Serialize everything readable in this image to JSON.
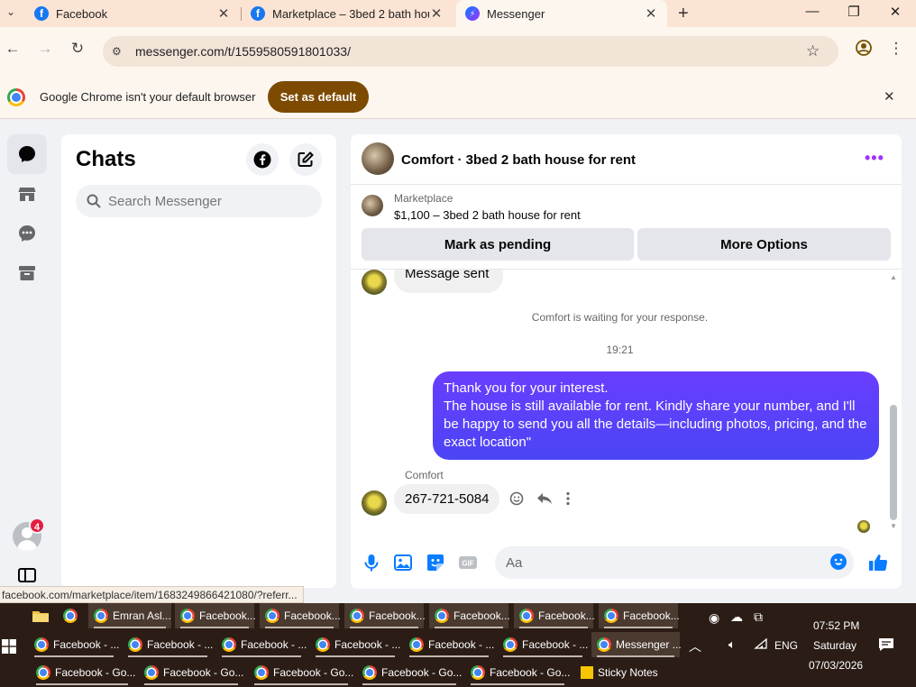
{
  "browser": {
    "tabs": [
      {
        "title": "Facebook",
        "icon": "facebook-icon"
      },
      {
        "title": "Marketplace – 3bed 2 bath hou",
        "icon": "facebook-icon"
      },
      {
        "title": "Messenger",
        "icon": "messenger-icon",
        "active": true
      }
    ],
    "url": "messenger.com/t/1559580591801033/",
    "infobar": {
      "message": "Google Chrome isn't your default browser",
      "button": "Set as default"
    },
    "status_url": "facebook.com/marketplace/item/1683249866421080/?referr..."
  },
  "rail": {
    "badge_count": "4"
  },
  "chats": {
    "title": "Chats",
    "search_placeholder": "Search Messenger"
  },
  "conversation": {
    "name": "Comfort · 3bed 2 bath house for rent",
    "marketplace_label": "Marketplace",
    "listing": "$1,100 – 3bed 2 bath house for rent",
    "buttons": {
      "mark_pending": "Mark as pending",
      "more_options": "More Options"
    },
    "messages": {
      "partial_sent": "Message sent",
      "waiting": "Comfort is waiting for your response.",
      "time": "19:21",
      "outgoing_lines": [
        "Thank you for your interest.",
        "The house is still available for rent. Kindly share your number, and I'll be happy to send you all the details—including photos, pricing, and the exact location\""
      ],
      "sender": "Comfort",
      "incoming": "267-721-5084"
    },
    "composer_placeholder": "Aa"
  },
  "taskbar": {
    "row1": [
      "Emran Asl...",
      "Facebook...",
      "Facebook...",
      "Facebook...",
      "Facebook...",
      "Facebook...",
      "Facebook..."
    ],
    "row2": [
      "Facebook - ...",
      "Facebook - ...",
      "Facebook - ...",
      "Facebook - ...",
      "Facebook - ...",
      "Facebook - ...",
      "Messenger ..."
    ],
    "row3": [
      "Facebook - Go...",
      "Facebook - Go...",
      "Facebook - Go...",
      "Facebook - Go...",
      "Facebook - Go...",
      "Sticky Notes"
    ],
    "language": "ENG",
    "time": "07:52 PM",
    "day": "Saturday",
    "date": "07/03/2026"
  }
}
